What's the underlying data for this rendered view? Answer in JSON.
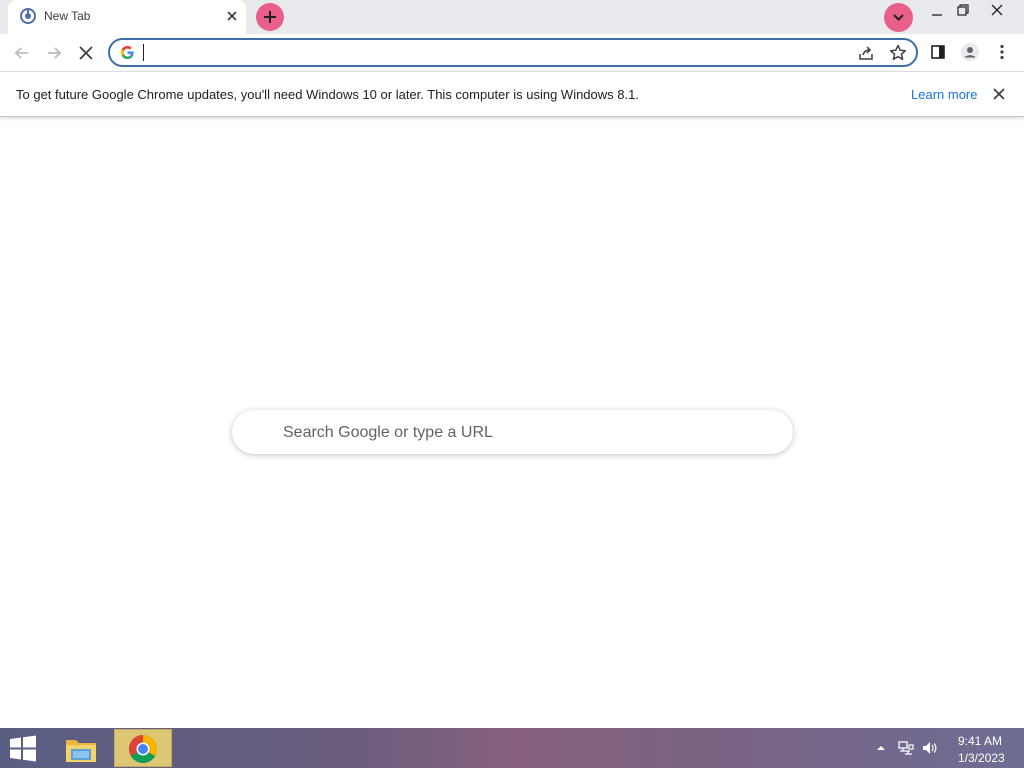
{
  "tab": {
    "title": "New Tab",
    "favicon": "chrome-newtab-icon"
  },
  "window_controls": {
    "minimize": "minimize-icon",
    "restore": "restore-icon",
    "close": "close-icon"
  },
  "toolbar": {
    "omnibox_value": "",
    "icons": [
      "back-arrow-icon",
      "forward-arrow-icon",
      "stop-icon",
      "google-g-icon",
      "share-icon",
      "star-icon",
      "side-panel-icon",
      "profile-icon",
      "kebab-menu-icon"
    ]
  },
  "infobar": {
    "message": "To get future Google Chrome updates, you'll need Windows 10 or later. This computer is using Windows 8.1.",
    "link": "Learn more"
  },
  "ntp": {
    "search_placeholder": "Search Google or type a URL"
  },
  "taskbar": {
    "items": [
      "windows-start-icon",
      "file-explorer-icon",
      "chrome-icon"
    ],
    "clock_time": "9:41 AM",
    "clock_date": "1/3/2023"
  },
  "colors": {
    "accent": "#1a73e8",
    "pink_buttons": "#e8608a",
    "tabstrip": "#e8eaed",
    "taskbar_active": "#dcc775"
  }
}
